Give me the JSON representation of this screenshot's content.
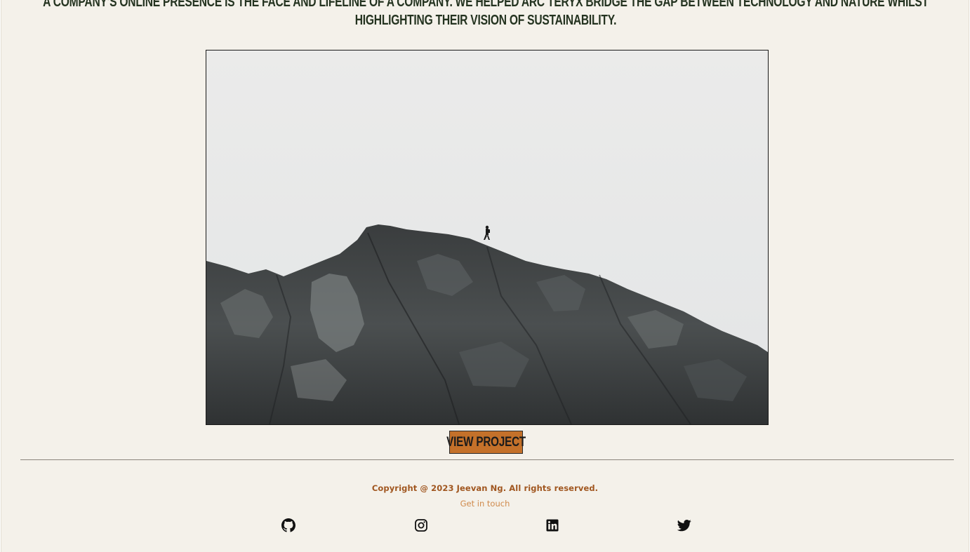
{
  "intro": {
    "text": "A company's online presence is the face and lifeline of a company. We helped Arc Teryx bridge the gap between technology and nature whilst highlighting their vision of sustainability."
  },
  "project": {
    "image_alt": "Hiker standing on a rocky mountain ridge against a grey sky",
    "button_label": "View Project"
  },
  "footer": {
    "copyright": "Copyright @ 2023 Jeevan Ng. All rights reserved.",
    "contact_link": "Get in touch",
    "social": [
      {
        "icon": "github-icon",
        "label": "GitHub"
      },
      {
        "icon": "instagram-icon",
        "label": "Instagram"
      },
      {
        "icon": "linkedin-icon",
        "label": "LinkedIn"
      },
      {
        "icon": "twitter-icon",
        "label": "Twitter"
      }
    ]
  },
  "colors": {
    "background": "#f4f1ea",
    "heading": "#243320",
    "button": "#c4712a",
    "copyright": "#a0561f",
    "link": "#d08a4c"
  }
}
